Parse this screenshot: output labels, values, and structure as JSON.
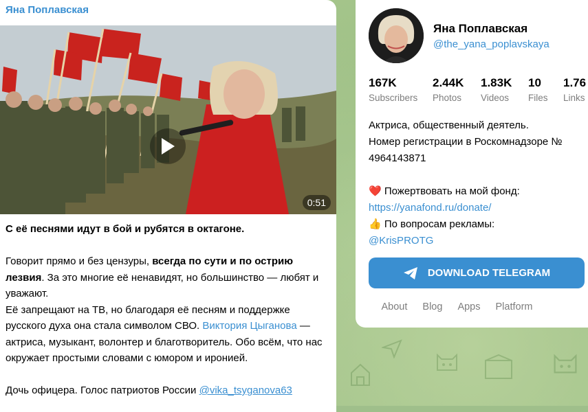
{
  "post": {
    "author": "Яна Поплавская",
    "video": {
      "duration": "0:51"
    },
    "headline": "С её песнями идут в бой и рубятся в октагоне.",
    "para1_pre": "Говорит прямо и без цензуры, ",
    "para1_bold": "всегда по сути и по острию лезвия",
    "para1_post": ". За это многие её ненавидят, но большинство — любят и уважают.",
    "para2_pre": "Её запрещают на ТВ, но благодаря её песням и поддержке русского духа она стала символом СВО. ",
    "para2_link": "Виктория Цыганова",
    "para2_post": " — актриса, музыкант, волонтер и благотворитель. Обо всём, что нас окружает простыми словами с юмором и иронией.",
    "para3_pre": "Дочь офицера. Голос патриотов России ",
    "para3_link": "@vika_tsyganova63"
  },
  "channel": {
    "name": "Яна Поплавская",
    "handle": "@the_yana_poplavskaya",
    "stats": [
      {
        "num": "167K",
        "label": "Subscribers"
      },
      {
        "num": "2.44K",
        "label": "Photos"
      },
      {
        "num": "1.83K",
        "label": "Videos"
      },
      {
        "num": "10",
        "label": "Files"
      },
      {
        "num": "1.76",
        "label": "Links"
      }
    ],
    "desc_line1": "Актриса, общественный деятель.",
    "desc_line2": "Номер регистрации в Роскомнадзоре № 4964143871",
    "donate_emoji": "❤️",
    "donate_text": " Пожертвовать на мой фонд:",
    "donate_link": "https://yanafond.ru/donate/",
    "ads_emoji": "👍",
    "ads_text": " По вопросам рекламы:",
    "ads_link": "@KrisPROTG",
    "download_label": "DOWNLOAD TELEGRAM"
  },
  "footer": {
    "about": "About",
    "blog": "Blog",
    "apps": "Apps",
    "platform": "Platform"
  },
  "colors": {
    "accent": "#3a8fd1",
    "background": "#9fbf8b"
  }
}
